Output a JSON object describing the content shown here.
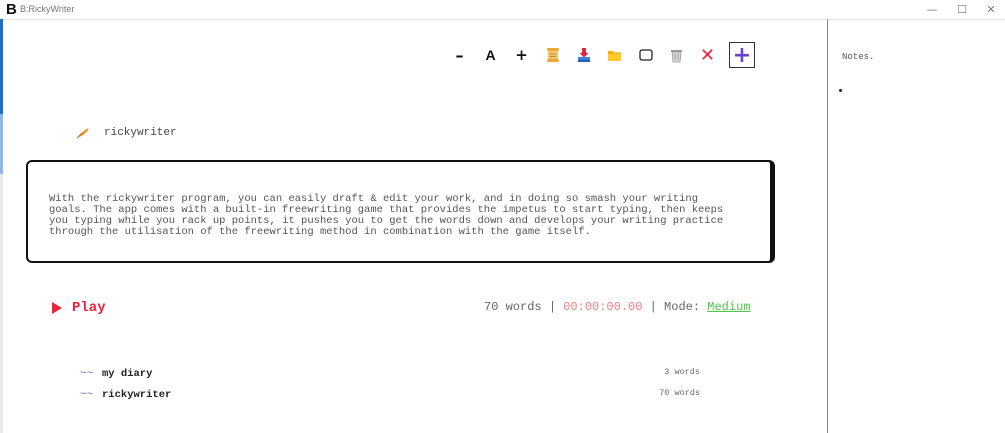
{
  "window": {
    "logo": "B",
    "title": "B:RickyWriter"
  },
  "toolbar": {
    "decrease_font": "–",
    "font": "A",
    "increase_font": "+",
    "close_symbol": "✕",
    "add_symbol": "+"
  },
  "document": {
    "title": "rickywriter",
    "body": "With the rickywriter program, you can easily draft & edit your work, and in doing so smash your writing\ngoals. The app comes with a built-in freewriting game that provides the impetus to start typing, then keeps\nyou typing while you rack up points, it pushes you to get the words down and develops your writing practice\nthrough the utilisation of the freewriting method in combination with the game itself."
  },
  "game": {
    "play_label": "Play",
    "word_count": "70 words",
    "separator": "|",
    "timer": "00:00:00.00",
    "mode_label": "Mode:",
    "mode_value": "Medium"
  },
  "documents": [
    {
      "icon": "~~",
      "name": "my diary",
      "count": "3 words"
    },
    {
      "icon": "~~",
      "name": "rickywriter",
      "count": "70 words"
    }
  ],
  "notes": {
    "title": "Notes."
  },
  "colors": {
    "accent_red": "#e8233c",
    "mode_green": "#4cc64a",
    "timer_pink": "#f08080",
    "add_purple": "#6a3fd1"
  }
}
